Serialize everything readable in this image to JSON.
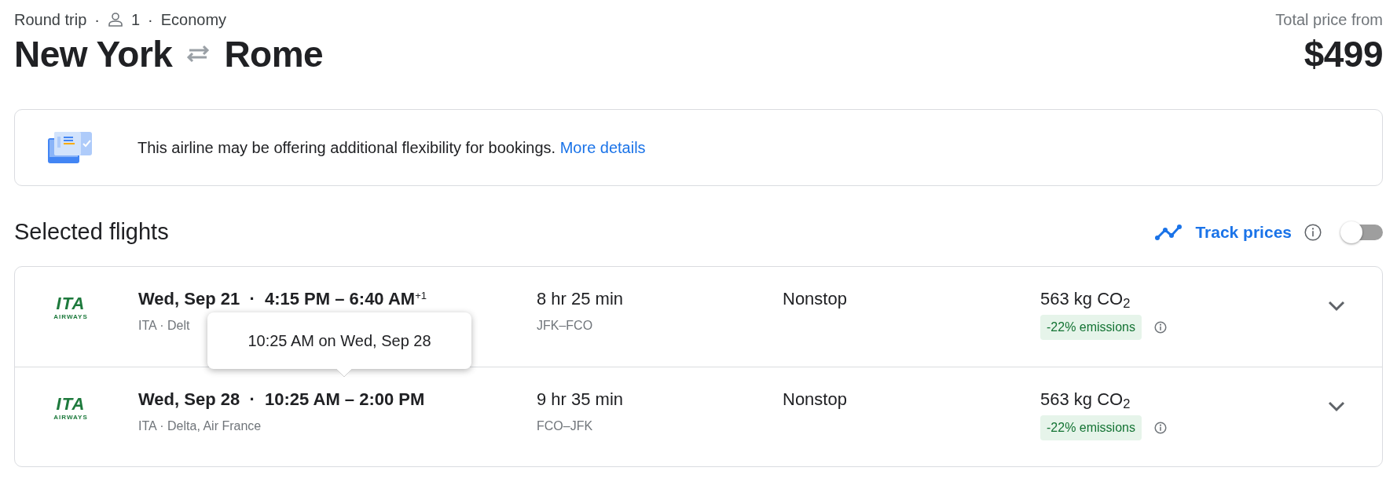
{
  "header": {
    "trip_type": "Round trip",
    "separator": "·",
    "passengers": "1",
    "cabin": "Economy",
    "origin": "New York",
    "destination": "Rome",
    "price_label": "Total price from",
    "price": "$499"
  },
  "banner": {
    "text": "This airline may be offering additional flexibility for bookings.",
    "link": "More details"
  },
  "section_title": "Selected flights",
  "track_prices": {
    "label": "Track prices",
    "on": false
  },
  "flights": [
    {
      "logo_mark": "ITA",
      "logo_sub": "AIRWAYS",
      "title": "Wed, Sep 21  ·  4:15 PM – 6:40 AM$^{+1}$",
      "airlines": "ITA · Delt",
      "duration": "8 hr 25 min",
      "route": "JFK–FCO",
      "stops": "Nonstop",
      "emissions": "563 kg CO$_{2}$",
      "emissions_badge": "-22% emissions",
      "expanded": false
    },
    {
      "logo_mark": "ITA",
      "logo_sub": "AIRWAYS",
      "title": "Wed, Sep 28  ·  10:25 AM – 2:00 PM",
      "airlines": "ITA · Delta, Air France",
      "duration": "9 hr 35 min",
      "route": "FCO–JFK",
      "stops": "Nonstop",
      "emissions": "563 kg CO$_{2}$",
      "emissions_badge": "-22% emissions",
      "expanded": false
    }
  ],
  "tooltip": {
    "text": "10:25 AM on Wed, Sep 28"
  }
}
